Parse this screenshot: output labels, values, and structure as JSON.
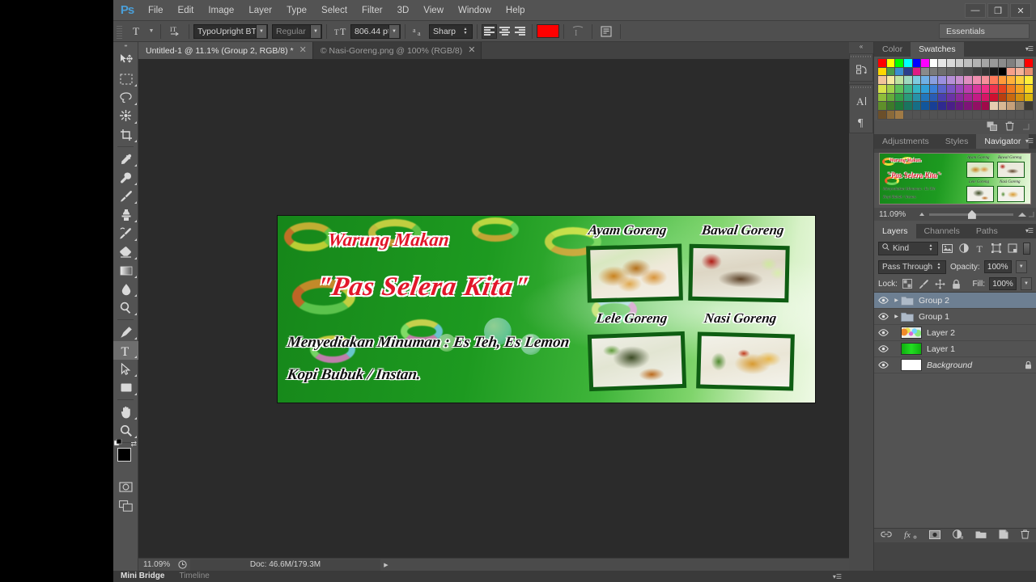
{
  "app": {
    "name": "Adobe Photoshop",
    "logo": "Ps"
  },
  "menubar": {
    "items": [
      "File",
      "Edit",
      "Image",
      "Layer",
      "Type",
      "Select",
      "Filter",
      "3D",
      "View",
      "Window",
      "Help"
    ],
    "window_controls": [
      {
        "name": "minimize",
        "glyph": "—"
      },
      {
        "name": "restore",
        "glyph": "❐"
      },
      {
        "name": "close",
        "glyph": "✕"
      }
    ]
  },
  "options_bar": {
    "tool_icon": "type-tool-icon",
    "orientation_icon": "text-orientation-icon",
    "font_family": "TypoUpright BT",
    "font_style": "Regular",
    "size_icon": "font-size-icon",
    "font_size": "806.44 pt",
    "antialias_icon": "anti-alias-icon",
    "antialias": "Sharp",
    "align": [
      "align-left",
      "align-center",
      "align-right"
    ],
    "align_active": 0,
    "text_color": "#ff0000",
    "warp_icon": "warp-text-icon",
    "panel_icon": "toggle-character-panel-icon",
    "workspace": "Essentials"
  },
  "tabs": [
    {
      "label": "Untitled-1 @ 11.1% (Group 2, RGB/8) *",
      "active": true,
      "close": "✕"
    },
    {
      "label": "© Nasi-Goreng.png @ 100% (RGB/8)",
      "active": false,
      "close": "✕"
    }
  ],
  "toolbox": {
    "tools": [
      {
        "name": "move-tool",
        "label": "Move",
        "active": false,
        "sub": false
      },
      {
        "name": "rectangular-marquee-tool",
        "label": "Rectangular Marquee",
        "active": false,
        "sub": true
      },
      {
        "name": "lasso-tool",
        "label": "Lasso",
        "active": false,
        "sub": true
      },
      {
        "name": "quick-selection-tool",
        "label": "Quick Selection",
        "active": false,
        "sub": true
      },
      {
        "name": "crop-tool",
        "label": "Crop",
        "active": false,
        "sub": true
      },
      {
        "name": "eyedropper-tool",
        "label": "Eyedropper",
        "active": false,
        "sub": true
      },
      {
        "name": "spot-healing-brush-tool",
        "label": "Spot Healing Brush",
        "active": false,
        "sub": true
      },
      {
        "name": "brush-tool",
        "label": "Brush",
        "active": false,
        "sub": true
      },
      {
        "name": "clone-stamp-tool",
        "label": "Clone Stamp",
        "active": false,
        "sub": true
      },
      {
        "name": "history-brush-tool",
        "label": "History Brush",
        "active": false,
        "sub": true
      },
      {
        "name": "eraser-tool",
        "label": "Eraser",
        "active": false,
        "sub": true
      },
      {
        "name": "gradient-tool",
        "label": "Gradient",
        "active": false,
        "sub": true
      },
      {
        "name": "blur-tool",
        "label": "Blur",
        "active": false,
        "sub": true
      },
      {
        "name": "dodge-tool",
        "label": "Dodge",
        "active": false,
        "sub": true
      },
      {
        "name": "pen-tool",
        "label": "Pen",
        "active": false,
        "sub": true
      },
      {
        "name": "type-tool",
        "label": "Horizontal Type",
        "active": true,
        "sub": true
      },
      {
        "name": "path-selection-tool",
        "label": "Path Selection",
        "active": false,
        "sub": true
      },
      {
        "name": "rectangle-tool",
        "label": "Rectangle",
        "active": false,
        "sub": true
      },
      {
        "name": "hand-tool",
        "label": "Hand",
        "active": false,
        "sub": true
      },
      {
        "name": "zoom-tool",
        "label": "Zoom",
        "active": false,
        "sub": false
      }
    ],
    "foreground_color": "#000000",
    "background_color": "#13d613",
    "quick_mask": "quick-mask-icon",
    "screen_mode": "screen-mode-icon"
  },
  "canvas": {
    "background": "#2b2b2b",
    "banner": {
      "title_line1": "Warung Makan",
      "title_line2": "\"Pas Selera Kita\"",
      "subtitle_line1": "Menyediakan Minuman : Es Teh, Es Lemon",
      "subtitle_line2": "Kopi Bubuk / Instan.",
      "text_color": "#e2162a",
      "bg_color": "#1c8a1c",
      "photos": [
        {
          "caption": "Ayam Goreng",
          "name": "photo-ayam-goreng"
        },
        {
          "caption": "Bawal Goreng",
          "name": "photo-bawal-goreng"
        },
        {
          "caption": "Lele Goreng",
          "name": "photo-lele-goreng"
        },
        {
          "caption": "Nasi Goreng",
          "name": "photo-nasi-goreng"
        }
      ]
    }
  },
  "status_bar": {
    "zoom": "11.09%",
    "doc_info": "Doc: 46.6M/179.3M",
    "arrow": "▶"
  },
  "bottom_bar": {
    "tabs": [
      {
        "label": "Mini Bridge",
        "active": true
      },
      {
        "label": "Timeline",
        "active": false
      }
    ]
  },
  "dock_strip": {
    "collapse": "«",
    "buttons": [
      {
        "name": "history-panel-icon",
        "glyph": "↻"
      },
      {
        "name": "character-panel-icon",
        "glyph": "A"
      },
      {
        "name": "paragraph-panel-icon",
        "glyph": "¶"
      }
    ]
  },
  "panels": {
    "color_group": {
      "tabs": [
        {
          "label": "Color",
          "active": false
        },
        {
          "label": "Swatches",
          "active": true
        }
      ],
      "menu_icon": "panel-menu-icon",
      "footer_icons": [
        {
          "name": "new-swatch-icon",
          "glyph": "▣"
        },
        {
          "name": "delete-swatch-icon",
          "glyph": "🗑"
        }
      ],
      "swatches": [
        "#ff0000",
        "#ffff00",
        "#00ff00",
        "#00ffff",
        "#0000ff",
        "#ff00ff",
        "#ffffff",
        "#e6e6e6",
        "#d9d9d9",
        "#cccccc",
        "#bfbfbf",
        "#b3b3b3",
        "#a6a6a6",
        "#999999",
        "#8c8c8c",
        "#808080",
        "#a6a6a6",
        "#ff0000",
        "#ffd700",
        "#4a9b4a",
        "#3a8ed0",
        "#2b3f8c",
        "#e01b84",
        "#8a8a8a",
        "#7a7a7a",
        "#6e6e6e",
        "#636363",
        "#575757",
        "#4b4b4b",
        "#3f3f3f",
        "#333333",
        "#1a1a1a",
        "#000000",
        "#f6a08a",
        "#f4b39a",
        "#e89070",
        "#f2c49a",
        "#f7e9a0",
        "#bfe3a0",
        "#9fd9c0",
        "#7ecbe0",
        "#6fb0e6",
        "#8a9fe0",
        "#9b8fe0",
        "#b68fd8",
        "#c98fd0",
        "#e08fc0",
        "#f08fb0",
        "#f58f9a",
        "#ff7a5a",
        "#ff9a3a",
        "#ffb03a",
        "#ffd13a",
        "#ffee3a",
        "#d7e24a",
        "#9fd04a",
        "#5ec25a",
        "#3fb58a",
        "#33b5c4",
        "#2f9fd8",
        "#3a7fd8",
        "#5a63cc",
        "#7a53c4",
        "#9a47bc",
        "#bb3fae",
        "#d8369c",
        "#ef2f86",
        "#f0324f",
        "#e8431f",
        "#ef7a1f",
        "#f4a21f",
        "#f9d31f",
        "#8fbe3a",
        "#64ab3a",
        "#34a04a",
        "#2a9a7a",
        "#2792a8",
        "#2277bc",
        "#2a5cb4",
        "#4a3fae",
        "#6a33a6",
        "#8a2b9e",
        "#a82394",
        "#c41b86",
        "#d81566",
        "#cf1030",
        "#b9400f",
        "#c96a0f",
        "#d4900f",
        "#dcb70f",
        "#5f8f2a",
        "#3d7a2a",
        "#1f7a3a",
        "#1a7460",
        "#166e86",
        "#12569c",
        "#183f96",
        "#2f2a90",
        "#4a1f88",
        "#661980",
        "#7e1478",
        "#920f64",
        "#a00a4a",
        "#e6cdb0",
        "#d8b894",
        "#c6a07a",
        "#8a7a62",
        "#3c3a33",
        "#6b4f2a",
        "#8a6a3a",
        "#a07a45",
        "#535353",
        "#535353",
        "#535353",
        "#535353",
        "#535353",
        "#535353",
        "#535353",
        "#535353",
        "#535353",
        "#535353",
        "#535353",
        "#535353",
        "#535353",
        "#535353",
        "#535353"
      ]
    },
    "navigator_group": {
      "tabs": [
        {
          "label": "Adjustments",
          "active": false
        },
        {
          "label": "Styles",
          "active": false
        },
        {
          "label": "Navigator",
          "active": true
        }
      ],
      "menu_icon": "panel-menu-icon",
      "zoom_percent": "11.09%",
      "zoom_out_icon": "zoom-out-icon",
      "zoom_in_icon": "zoom-in-icon",
      "resize_icon": "resize-grip-icon"
    },
    "layers_group": {
      "tabs": [
        {
          "label": "Layers",
          "active": true
        },
        {
          "label": "Channels",
          "active": false
        },
        {
          "label": "Paths",
          "active": false
        }
      ],
      "menu_icon": "panel-menu-icon",
      "filter": {
        "search_icon": "search-icon",
        "kind": "Kind",
        "type_filters": [
          {
            "name": "filter-pixel-icon",
            "glyph": "▤"
          },
          {
            "name": "filter-adjustment-icon",
            "glyph": "◐"
          },
          {
            "name": "filter-type-icon",
            "glyph": "T"
          },
          {
            "name": "filter-shape-icon",
            "glyph": "⬚"
          },
          {
            "name": "filter-smart-object-icon",
            "glyph": "❏"
          }
        ],
        "toggle": "filter-enable-toggle"
      },
      "blend_mode": "Pass Through",
      "opacity_label": "Opacity:",
      "opacity_value": "100%",
      "lock_label": "Lock:",
      "lock_icons": [
        {
          "name": "lock-transparent-pixels-icon",
          "glyph": "▦"
        },
        {
          "name": "lock-image-pixels-icon",
          "glyph": "✎"
        },
        {
          "name": "lock-position-icon",
          "glyph": "✥"
        },
        {
          "name": "lock-all-icon",
          "glyph": "🔒"
        }
      ],
      "fill_label": "Fill:",
      "fill_value": "100%",
      "layers": [
        {
          "name": "Group 2",
          "type": "group",
          "selected": true,
          "visible": true,
          "expandable": true,
          "locked": false,
          "italic": false,
          "thumb": "#9aa8b8"
        },
        {
          "name": "Group 1",
          "type": "group",
          "selected": false,
          "visible": true,
          "expandable": true,
          "locked": false,
          "italic": false,
          "thumb": "#9aa8b8"
        },
        {
          "name": "Layer 2",
          "type": "pixel",
          "selected": false,
          "visible": true,
          "expandable": false,
          "locked": false,
          "italic": false,
          "thumb": "multicolor"
        },
        {
          "name": "Layer 1",
          "type": "pixel",
          "selected": false,
          "visible": true,
          "expandable": false,
          "locked": false,
          "italic": false,
          "thumb": "#10c410"
        },
        {
          "name": "Background",
          "type": "pixel",
          "selected": false,
          "visible": true,
          "expandable": false,
          "locked": true,
          "italic": true,
          "thumb": "#ffffff"
        }
      ],
      "footer_icons": [
        {
          "name": "link-layers-icon",
          "glyph": "🔗"
        },
        {
          "name": "layer-style-icon",
          "glyph": "fx"
        },
        {
          "name": "layer-mask-icon",
          "glyph": "◙"
        },
        {
          "name": "new-fill-adjustment-icon",
          "glyph": "◑"
        },
        {
          "name": "new-group-icon",
          "glyph": "🗀"
        },
        {
          "name": "new-layer-icon",
          "glyph": "❐"
        },
        {
          "name": "delete-layer-icon",
          "glyph": "🗑"
        }
      ]
    }
  }
}
